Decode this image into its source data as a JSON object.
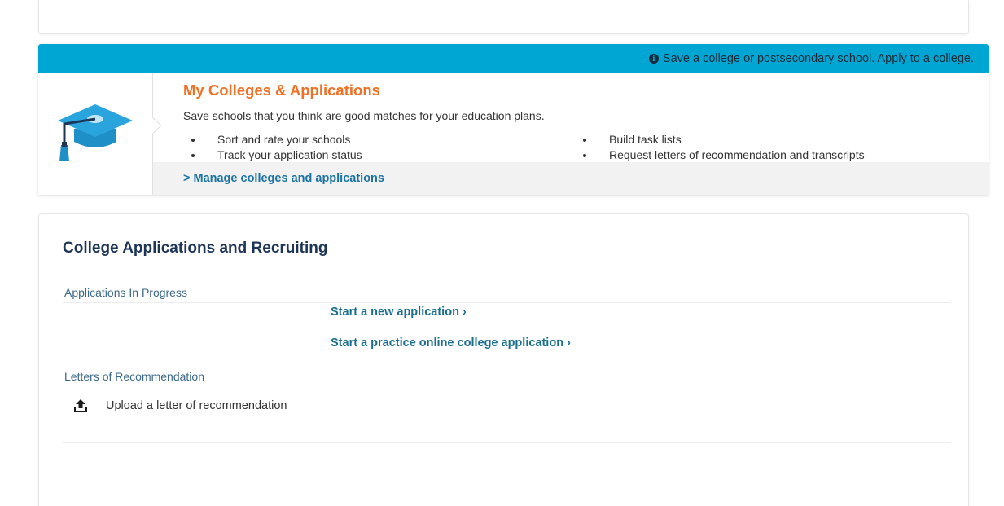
{
  "banner": {
    "notice": "Save a college or postsecondary school. Apply to a college.",
    "title": "My Colleges & Applications",
    "description": "Save schools that you think are good matches for your education plans.",
    "bullets_left": [
      "Sort and rate your schools",
      "Track your application status"
    ],
    "bullets_right": [
      "Build task lists",
      "Request letters of recommendation and transcripts"
    ],
    "manage_link": "> Manage colleges and applications",
    "icon": "graduation-cap-icon",
    "colors": {
      "bar": "#00a6d3",
      "title": "#f07125",
      "link": "#1a73a3"
    }
  },
  "main": {
    "title": "College Applications and Recruiting",
    "applications_label": "Applications In Progress",
    "start_new": "Start a new application ›",
    "start_practice": "Start a practice online college application ›",
    "letters_label": "Letters of Recommendation",
    "upload_text": "Upload a letter of recommendation",
    "upload_icon": "upload-icon"
  }
}
